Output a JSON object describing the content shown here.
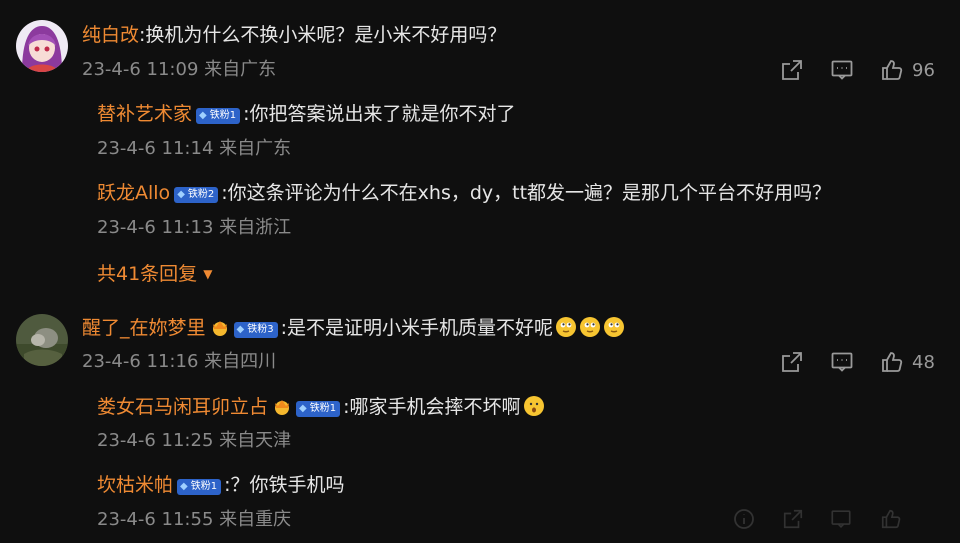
{
  "comments": [
    {
      "user": "纯白改",
      "text": "换机为什么不换小米呢？是小米不好用吗？",
      "time": "23-4-6 11:09",
      "location": "来自广东",
      "likes": "96",
      "replies": [
        {
          "user": "替补艺术家",
          "badge": "铁粉1",
          "text": "你把答案说出来了就是你不对了",
          "time": "23-4-6 11:14",
          "location": "来自广东"
        },
        {
          "user": "跃龙Allo",
          "badge": "铁粉2",
          "text": "你这条评论为什么不在xhs，dy，tt都发一遍？是那几个平台不好用吗？",
          "time": "23-4-6 11:13",
          "location": "来自浙江"
        }
      ],
      "more_replies": "共41条回复"
    },
    {
      "user": "醒了_在妳梦里",
      "badge": "铁粉3",
      "text": "是不是证明小米手机质量不好呢",
      "time": "23-4-6 11:16",
      "location": "来自四川",
      "likes": "48",
      "replies": [
        {
          "user": "娄女石马闲耳卯立占",
          "badge": "铁粉1",
          "text": "哪家手机会摔不坏啊",
          "time": "23-4-6 11:25",
          "location": "来自天津"
        },
        {
          "user": "坎枯米帕",
          "badge": "铁粉1",
          "text": "？你铁手机吗",
          "time": "23-4-6 11:55",
          "location": "来自重庆"
        }
      ]
    }
  ],
  "colors": {
    "background": "#0f0f0f",
    "username": "#ef8a33",
    "badge": "#2d63c9",
    "meta": "#8a8a8a"
  }
}
